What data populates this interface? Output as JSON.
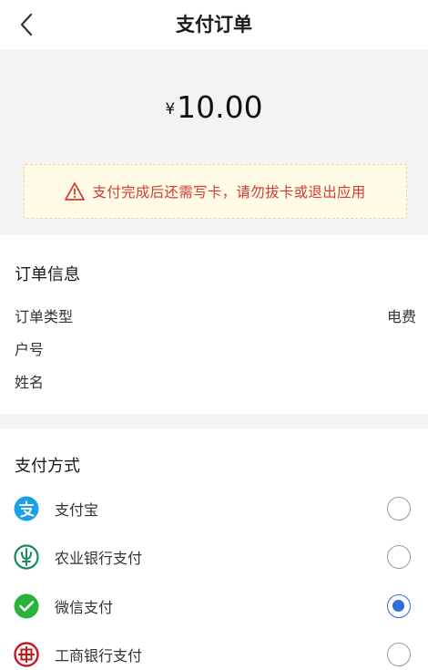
{
  "header": {
    "title": "支付订单"
  },
  "amount": {
    "currency": "¥",
    "value": "10.00"
  },
  "warning": {
    "text": "支付完成后还需写卡，请勿拔卡或退出应用",
    "color": "#d43a36"
  },
  "order_info": {
    "title": "订单信息",
    "rows": [
      {
        "label": "订单类型",
        "value": "电费"
      },
      {
        "label": "户号",
        "value": ""
      },
      {
        "label": "姓名",
        "value": ""
      }
    ]
  },
  "payment": {
    "title": "支付方式",
    "methods": [
      {
        "label": "支付宝",
        "icon": "alipay-icon",
        "color": "#1aa0e8",
        "selected": false
      },
      {
        "label": "农业银行支付",
        "icon": "abc-bank-icon",
        "color": "#1a8a5a",
        "selected": false
      },
      {
        "label": "微信支付",
        "icon": "wechat-pay-icon",
        "color": "#2ab33a",
        "selected": true
      },
      {
        "label": "工商银行支付",
        "icon": "icbc-bank-icon",
        "color": "#c8161d",
        "selected": false
      }
    ],
    "accent": "#2e6fd6"
  }
}
